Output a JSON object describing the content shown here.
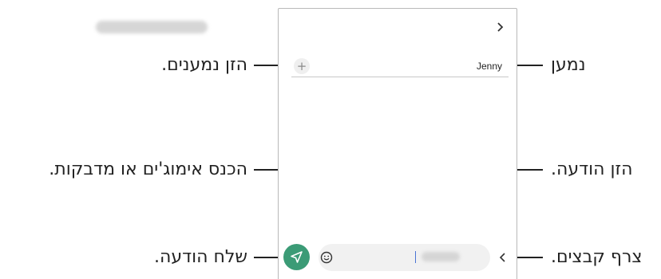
{
  "phone": {
    "header": {
      "title_blurred": true,
      "back_icon": "chevron-right-icon"
    },
    "recipients": {
      "name": "Jenny",
      "add_icon": "plus-icon"
    },
    "composer": {
      "emoji_icon": "emoji-icon",
      "attach_icon": "chevron-left-icon",
      "send_icon": "send-icon"
    }
  },
  "callouts": {
    "enter_recipients": "הזן נמענים.",
    "recipient": "נמען",
    "emoji_stickers": "הכנס אימוג'ים או מדבקות.",
    "enter_message": "הזן הודעה.",
    "send_message": "שלח הודעה.",
    "attach_files": "צרף קבצים."
  },
  "colors": {
    "send_button": "#3b9b76",
    "line": "#222222",
    "frame": "#b9b9b9"
  }
}
